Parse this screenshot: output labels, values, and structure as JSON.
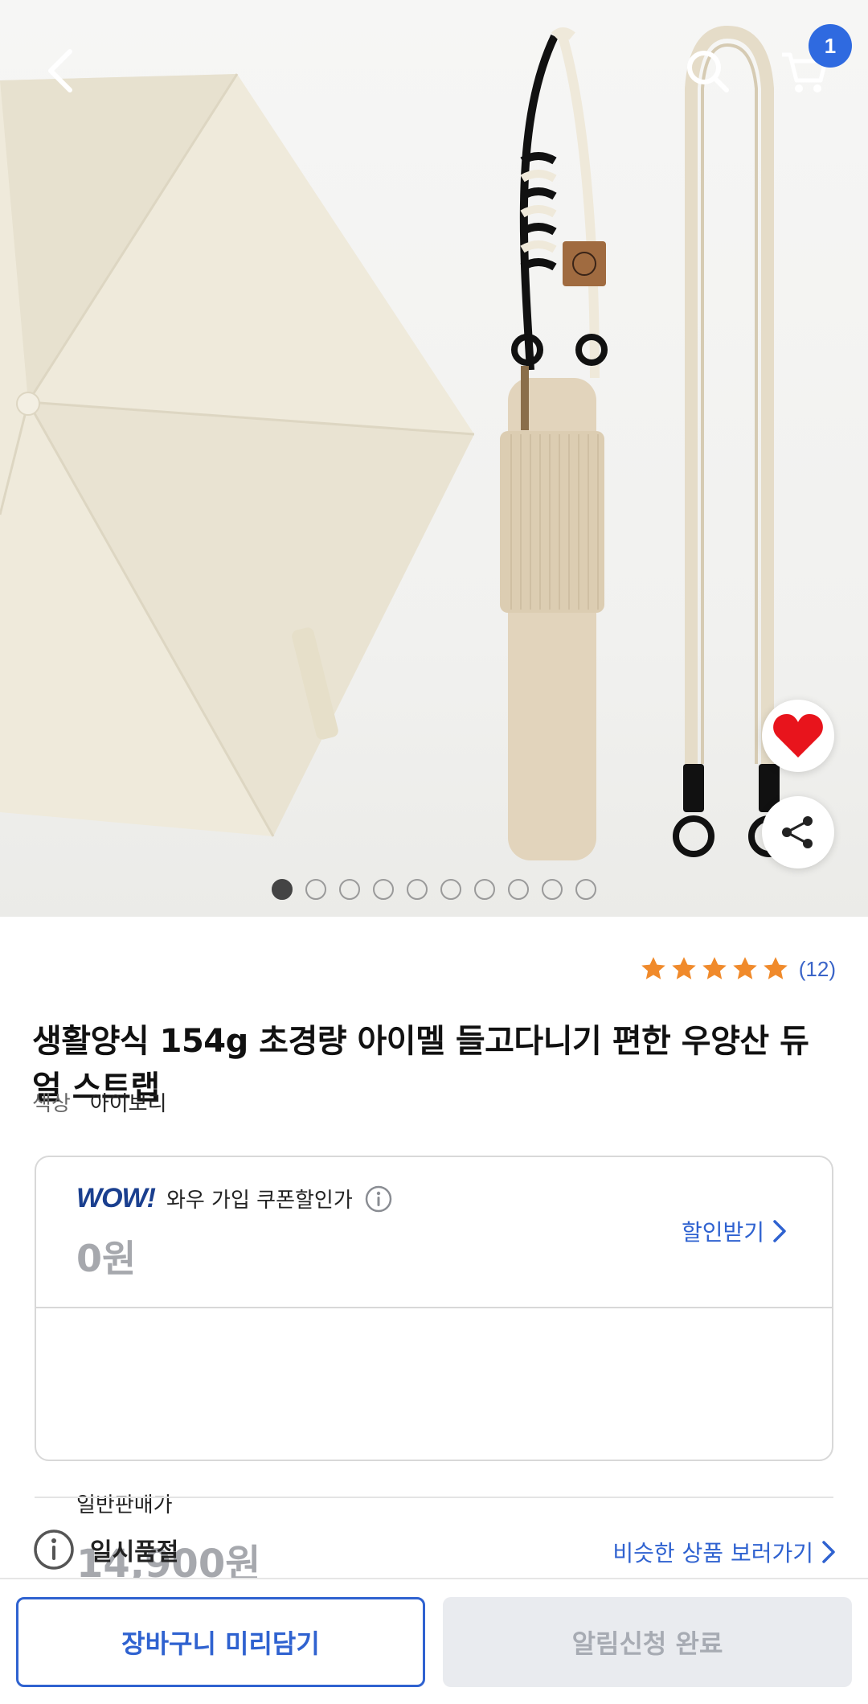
{
  "header": {
    "cart_badge": "1"
  },
  "gallery": {
    "total_images": 10,
    "active_index": 0
  },
  "rating": {
    "stars": 5,
    "count": "(12)"
  },
  "product": {
    "title": "생활양식 154g 초경량 아이멜 들고다니기 편한 우양산 듀얼 스트랩",
    "option_label": "색상",
    "option_value": "아이보리"
  },
  "price": {
    "wow_logo": "WOW!",
    "wow_text": "와우 가입 쿠폰할인가",
    "coupon_price": "0원",
    "discount_link": "할인받기",
    "normal_label": "일반판매가",
    "normal_price": "14,900원"
  },
  "stock": {
    "status": "일시품절",
    "similar_link": "비슷한 상품 보러가기"
  },
  "bottom_bar": {
    "cart_button": "장바구니 미리담기",
    "notify_button": "알림신청 완료"
  },
  "colors": {
    "accent": "#2f62d0",
    "star": "#f08a2b",
    "heart": "#e8141c"
  }
}
